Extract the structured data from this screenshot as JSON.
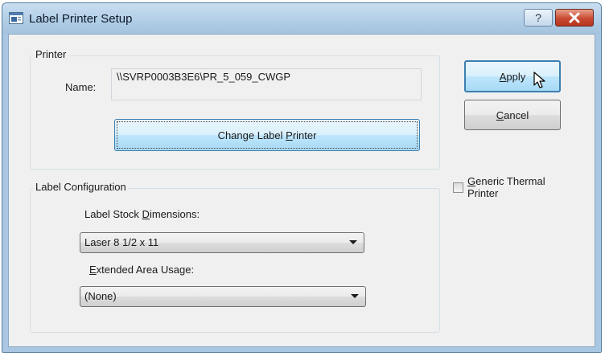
{
  "window": {
    "title": "Label Printer Setup",
    "help_glyph": "?"
  },
  "printer": {
    "group_label": "Printer",
    "name_label": "Name:",
    "name_value": "\\\\SVRP0003B3E6\\PR_5_059_CWGP",
    "change_button_pre": "Change Label ",
    "change_button_mn": "P",
    "change_button_post": "rinter"
  },
  "label_config": {
    "group_label": "Label Configuration",
    "stock_label_pre": "Label Stock ",
    "stock_label_mn": "D",
    "stock_label_post": "imensions:",
    "stock_value": "Laser 8 1/2 x 11",
    "extended_label_mn": "E",
    "extended_label_post": "xtended Area Usage:",
    "extended_value": "(None)"
  },
  "buttons": {
    "apply_mn": "A",
    "apply_post": "pply",
    "cancel_mn": "C",
    "cancel_post": "ancel"
  },
  "generic_thermal": {
    "label_mn": "G",
    "label_line1_post": "eneric Thermal",
    "label_line2": "Printer",
    "checked": false
  },
  "colors": {
    "title_bar": "#b0cde6",
    "close_button": "#c74a31",
    "focus_button": "#bee6fd"
  }
}
